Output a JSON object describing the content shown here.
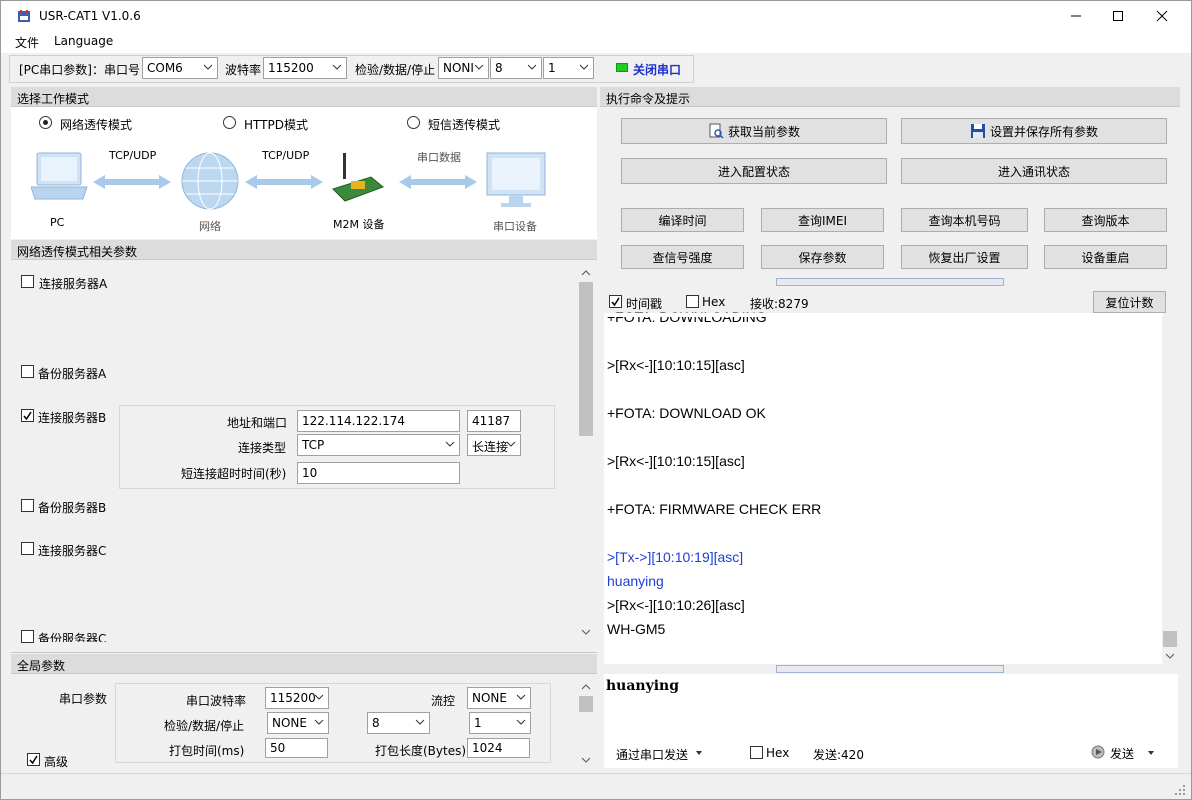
{
  "window": {
    "title": "USR-CAT1 V1.0.6"
  },
  "menu": {
    "file": "文件",
    "language": "Language"
  },
  "serial": {
    "prefix": "[PC串口参数]：串口号",
    "port": "COM6",
    "baud_label": "波特率",
    "baud": "115200",
    "parity_label": "检验/数据/停止",
    "parity": "NONI",
    "databits": "8",
    "stopbits": "1",
    "close_port": "关闭串口",
    "status_color": "#22cc22"
  },
  "mode": {
    "header": "选择工作模式",
    "options": [
      "网络透传模式",
      "HTTPD模式",
      "短信透传模式"
    ],
    "selected": "网络透传模式",
    "diagram": {
      "pc": "PC",
      "net": "网络",
      "m2m": "M2M 设备",
      "serial_dev": "串口设备",
      "tcpudp1": "TCP/UDP",
      "tcpudp2": "TCP/UDP",
      "serial_data": "串口数据"
    }
  },
  "net_params": {
    "header": "网络透传模式相关参数",
    "servers": [
      {
        "label": "连接服务器A",
        "checked": false
      },
      {
        "label": "备份服务器A",
        "checked": false
      },
      {
        "label": "连接服务器B",
        "checked": true
      },
      {
        "label": "备份服务器B",
        "checked": false
      },
      {
        "label": "连接服务器C",
        "checked": false
      },
      {
        "label": "备份服务器C",
        "checked": false
      }
    ],
    "addr_label": "地址和端口",
    "addr": "122.114.122.174",
    "port": "41187",
    "conn_type_label": "连接类型",
    "conn_type": "TCP",
    "conn_mode": "长连接",
    "timeout_label": "短连接超时时间(秒)",
    "timeout": "10"
  },
  "global": {
    "header": "全局参数",
    "serial_params": "串口参数",
    "baud_label": "串口波特率",
    "baud": "115200",
    "flow_label": "流控",
    "flow": "NONE",
    "parity_label": "检验/数据/停止",
    "parity": "NONE",
    "databits": "8",
    "stopbits": "1",
    "pack_time_label": "打包时间(ms)",
    "pack_time": "50",
    "pack_len_label": "打包长度(Bytes)",
    "pack_len": "1024",
    "advanced": "高级"
  },
  "commands": {
    "header": "执行命令及提示",
    "get_params": "获取当前参数",
    "save_params": "设置并保存所有参数",
    "enter_config": "进入配置状态",
    "enter_comm": "进入通讯状态",
    "row1": [
      "编译时间",
      "查询IMEI",
      "查询本机号码",
      "查询版本"
    ],
    "row2": [
      "查信号强度",
      "保存参数",
      "恢复出厂设置",
      "设备重启"
    ]
  },
  "receive": {
    "timestamp": "时间戳",
    "hex": "Hex",
    "count": "接收:8279",
    "reset": "复位计数",
    "log": [
      {
        "text": "+FOTA: DOWNLOADING",
        "color": "black"
      },
      {
        "text": ">[Rx<-][10:10:15][asc]",
        "color": "black"
      },
      {
        "text": "+FOTA: DOWNLOAD OK",
        "color": "black"
      },
      {
        "text": ">[Rx<-][10:10:15][asc]",
        "color": "black"
      },
      {
        "text": "+FOTA: FIRMWARE CHECK ERR",
        "color": "black"
      },
      {
        "text": ">[Tx->][10:10:19][asc]",
        "color": "blue"
      },
      {
        "text": "huanying",
        "color": "blue"
      },
      {
        "text": ">[Rx<-][10:10:26][asc]",
        "color": "black"
      },
      {
        "text": "WH-GM5",
        "color": "black"
      }
    ]
  },
  "send": {
    "text": "huanying",
    "via": "通过串口发送",
    "hex": "Hex",
    "count": "发送:420",
    "send": "发送"
  }
}
